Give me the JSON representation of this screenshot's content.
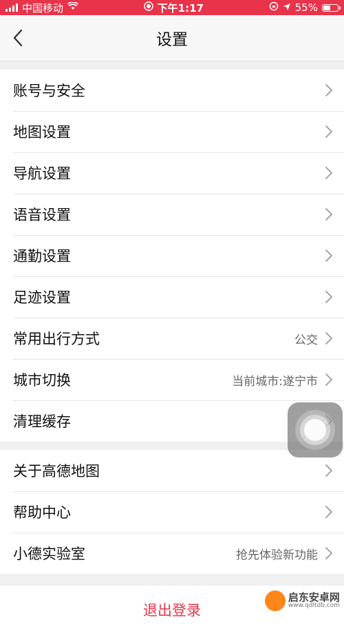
{
  "status_bar": {
    "carrier": "中国移动",
    "time": "下午1:17",
    "battery": "55%",
    "battery_level": 0.55,
    "icons": [
      "signal-icon",
      "wifi-icon",
      "record-icon",
      "lock-rotation-icon",
      "location-arrow-icon",
      "battery-icon"
    ]
  },
  "nav": {
    "title": "设置",
    "back_icon": "chevron-left-icon"
  },
  "settings": {
    "group1": [
      {
        "label": "账号与安全",
        "value": ""
      },
      {
        "label": "地图设置",
        "value": ""
      },
      {
        "label": "导航设置",
        "value": ""
      },
      {
        "label": "语音设置",
        "value": ""
      },
      {
        "label": "通勤设置",
        "value": ""
      },
      {
        "label": "足迹设置",
        "value": ""
      },
      {
        "label": "常用出行方式",
        "value": "公交"
      },
      {
        "label": "城市切换",
        "value": "当前城市:遂宁市"
      },
      {
        "label": "清理缓存",
        "value": ""
      }
    ],
    "group2": [
      {
        "label": "关于高德地图",
        "value": ""
      },
      {
        "label": "帮助中心",
        "value": ""
      },
      {
        "label": "小德实验室",
        "value": "抢先体验新功能"
      }
    ]
  },
  "logout": {
    "label": "退出登录"
  },
  "colors": {
    "accent": "#e8334a",
    "background": "#f0f0f0"
  },
  "watermark": {
    "title": "启东安卓网",
    "url": "www.qdltdb.com"
  }
}
